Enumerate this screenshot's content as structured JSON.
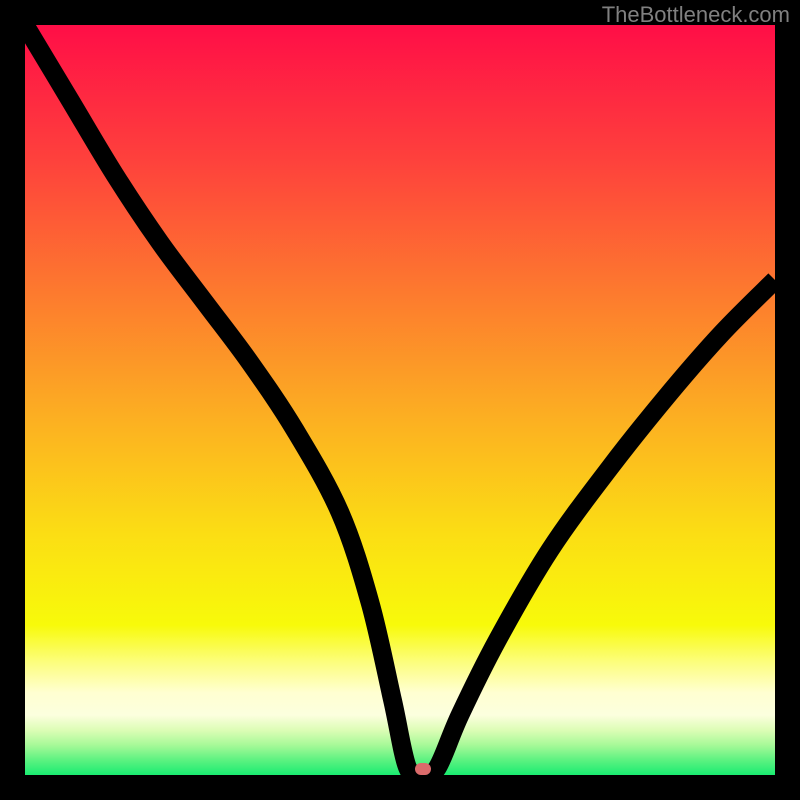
{
  "attribution": "TheBottleneck.com",
  "marker": {
    "x_pct": 53,
    "y_pct": 99.2,
    "color": "#DB6B6B"
  },
  "gradient_stops": [
    {
      "offset": 0,
      "color": "#FF0E47"
    },
    {
      "offset": 18,
      "color": "#FE413C"
    },
    {
      "offset": 36,
      "color": "#FD7B2E"
    },
    {
      "offset": 52,
      "color": "#FCAE22"
    },
    {
      "offset": 68,
      "color": "#FBDE14"
    },
    {
      "offset": 80,
      "color": "#F8FA0A"
    },
    {
      "offset": 85,
      "color": "#FCFE7E"
    },
    {
      "offset": 89,
      "color": "#FFFFD1"
    },
    {
      "offset": 92,
      "color": "#FCFFDE"
    },
    {
      "offset": 94,
      "color": "#DDFDB6"
    },
    {
      "offset": 96,
      "color": "#A7F998"
    },
    {
      "offset": 98,
      "color": "#5DF281"
    },
    {
      "offset": 100,
      "color": "#1AEC71"
    }
  ],
  "chart_data": {
    "type": "line",
    "title": "",
    "xlabel": "",
    "ylabel": "",
    "xlim": [
      0,
      100
    ],
    "ylim": [
      0,
      100
    ],
    "x": [
      0,
      6,
      12,
      18,
      24,
      30,
      36,
      42,
      46,
      49,
      51,
      53,
      55,
      58,
      63,
      70,
      78,
      86,
      93,
      100
    ],
    "values": [
      100,
      90,
      80,
      71,
      63,
      55,
      46,
      35,
      23,
      10,
      1,
      0,
      1,
      8,
      18,
      30,
      41,
      51,
      59,
      66
    ],
    "series_name": "bottleneck",
    "marker_x": 53,
    "marker_y": 0,
    "background": "vertical-gradient-red-to-green"
  }
}
